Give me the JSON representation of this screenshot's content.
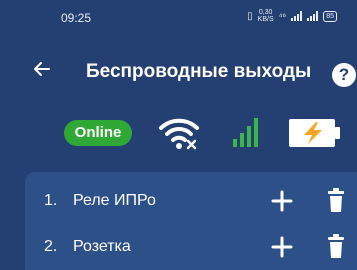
{
  "status_bar": {
    "time": "09:25",
    "speed_value": "0,30",
    "speed_unit": "KB/S",
    "net_type": "⁴⁶",
    "battery": "85"
  },
  "app_bar": {
    "title": "Беспроводные выходы",
    "back_icon": "arrow-left-icon",
    "help_label": "?"
  },
  "indicators": {
    "status_label": "Online",
    "status_color": "#2fa836",
    "wifi_icon": "wifi-disconnected-icon",
    "signal_icon": "signal-bars-icon",
    "battery_icon": "battery-charging-icon"
  },
  "outputs": [
    {
      "index": "1.",
      "label": "Реле ИПРо"
    },
    {
      "index": "2.",
      "label": "Розетка"
    }
  ]
}
